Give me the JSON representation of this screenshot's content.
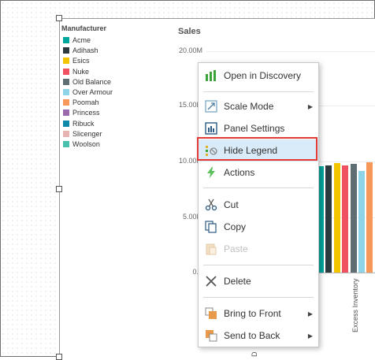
{
  "legend": {
    "title": "Manufacturer",
    "items": [
      {
        "label": "Acme",
        "color": "#00a59b"
      },
      {
        "label": "Adihash",
        "color": "#2c3a40"
      },
      {
        "label": "Esics",
        "color": "#f2c500"
      },
      {
        "label": "Nuke",
        "color": "#f05161"
      },
      {
        "label": "Old Balance",
        "color": "#5e6e73"
      },
      {
        "label": "Over Armour",
        "color": "#8ed3e8"
      },
      {
        "label": "Poomah",
        "color": "#f7975a"
      },
      {
        "label": "Princess",
        "color": "#9b69ac"
      },
      {
        "label": "Ribuck",
        "color": "#0e8aa8"
      },
      {
        "label": "Slicenger",
        "color": "#e7b4b3"
      },
      {
        "label": "Woolson",
        "color": "#49bfae"
      }
    ]
  },
  "chart": {
    "title": "Sales",
    "y_ticks": [
      "20.00M",
      "15.00M",
      "10.00M",
      "5.00M",
      "0.0"
    ],
    "x_label_partial": "Excess Inventory",
    "x_label_cut": "D"
  },
  "chart_data": {
    "type": "bar",
    "title": "Sales",
    "ylim": [
      0,
      20000000
    ],
    "categories": [
      "Excess Inventory"
    ],
    "series": [
      {
        "name": "Acme",
        "values": [
          9600000
        ]
      },
      {
        "name": "Adihash",
        "values": [
          9700000
        ]
      },
      {
        "name": "Esics",
        "values": [
          9900000
        ]
      },
      {
        "name": "Nuke",
        "values": [
          9700000
        ]
      },
      {
        "name": "Old Balance",
        "values": [
          9800000
        ]
      },
      {
        "name": "Over Armour",
        "values": [
          9200000
        ]
      },
      {
        "name": "Poomah",
        "values": [
          10000000
        ]
      },
      {
        "name": "Princess",
        "values": [
          9600000
        ]
      }
    ]
  },
  "menu": {
    "items": [
      {
        "key": "open_in_discovery",
        "label": "Open in Discovery",
        "icon": "bar-chart-icon"
      },
      {
        "key": "scale_mode",
        "label": "Scale Mode",
        "icon": "scale-icon",
        "submenu": true
      },
      {
        "key": "panel_settings",
        "label": "Panel Settings",
        "icon": "panel-settings-icon"
      },
      {
        "key": "hide_legend",
        "label": "Hide Legend",
        "icon": "hide-legend-icon",
        "highlighted": true
      },
      {
        "key": "actions",
        "label": "Actions",
        "icon": "lightning-icon"
      },
      {
        "key": "cut",
        "label": "Cut",
        "icon": "scissors-icon"
      },
      {
        "key": "copy",
        "label": "Copy",
        "icon": "copy-icon"
      },
      {
        "key": "paste",
        "label": "Paste",
        "icon": "paste-icon",
        "disabled": true
      },
      {
        "key": "delete",
        "label": "Delete",
        "icon": "delete-x-icon"
      },
      {
        "key": "bring_to_front",
        "label": "Bring to Front",
        "icon": "bring-front-icon",
        "submenu": true
      },
      {
        "key": "send_to_back",
        "label": "Send to Back",
        "icon": "send-back-icon",
        "submenu": true
      }
    ],
    "submenu_arrow": "▶"
  }
}
